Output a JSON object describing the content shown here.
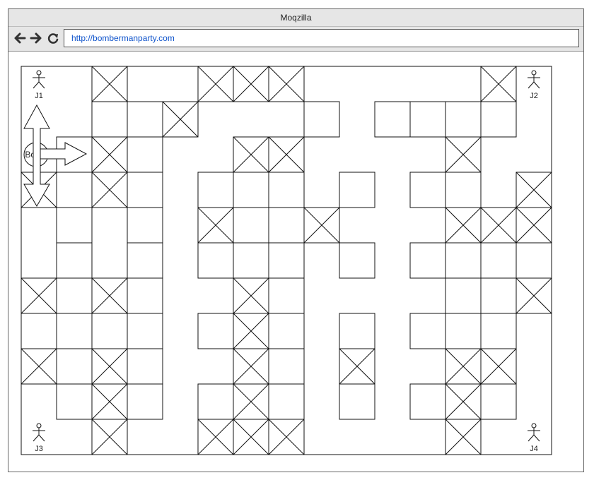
{
  "window": {
    "title": "Moqzilla"
  },
  "toolbar": {
    "back_icon": "arrow-left-icon",
    "forward_icon": "arrow-right-icon",
    "reload_icon": "reload-icon",
    "url": "http://bombermanparty.com"
  },
  "board": {
    "cols": 15,
    "rows": 11,
    "walls": [
      [
        2,
        1
      ],
      [
        3,
        1
      ],
      [
        4,
        1
      ],
      [
        8,
        1
      ],
      [
        10,
        1
      ],
      [
        11,
        1
      ],
      [
        12,
        1
      ],
      [
        13,
        1
      ],
      [
        0,
        3
      ],
      [
        1,
        3
      ],
      [
        3,
        3
      ],
      [
        5,
        3
      ],
      [
        7,
        3
      ],
      [
        9,
        3
      ],
      [
        11,
        3
      ],
      [
        12,
        3
      ],
      [
        14,
        3
      ],
      [
        1,
        5
      ],
      [
        3,
        5
      ],
      [
        5,
        5
      ],
      [
        7,
        5
      ],
      [
        9,
        5
      ],
      [
        11,
        5
      ],
      [
        13,
        5
      ],
      [
        1,
        7
      ],
      [
        3,
        7
      ],
      [
        5,
        7
      ],
      [
        7,
        7
      ],
      [
        9,
        7
      ],
      [
        11,
        7
      ],
      [
        13,
        7
      ],
      [
        1,
        9
      ],
      [
        3,
        9
      ],
      [
        5,
        9
      ],
      [
        7,
        9
      ],
      [
        9,
        9
      ],
      [
        11,
        9
      ],
      [
        13,
        9
      ],
      [
        1,
        2
      ],
      [
        2,
        2
      ],
      [
        1,
        4
      ],
      [
        1,
        6
      ],
      [
        1,
        8
      ],
      [
        3,
        2
      ],
      [
        3,
        4
      ],
      [
        3,
        6
      ],
      [
        3,
        8
      ],
      [
        6,
        2
      ],
      [
        6,
        4
      ],
      [
        6,
        6
      ],
      [
        6,
        8
      ],
      [
        7,
        2
      ],
      [
        7,
        4
      ],
      [
        7,
        6
      ],
      [
        7,
        8
      ],
      [
        12,
        2
      ],
      [
        12,
        4
      ],
      [
        12,
        6
      ],
      [
        12,
        8
      ]
    ],
    "crates": [
      [
        2,
        0
      ],
      [
        5,
        0
      ],
      [
        6,
        0
      ],
      [
        7,
        0
      ],
      [
        13,
        0
      ],
      [
        4,
        1
      ],
      [
        2,
        2
      ],
      [
        6,
        2
      ],
      [
        7,
        2
      ],
      [
        12,
        2
      ],
      [
        0,
        3
      ],
      [
        2,
        3
      ],
      [
        14,
        3
      ],
      [
        5,
        4
      ],
      [
        8,
        4
      ],
      [
        12,
        4
      ],
      [
        13,
        4
      ],
      [
        14,
        4
      ],
      [
        0,
        6
      ],
      [
        2,
        6
      ],
      [
        6,
        6
      ],
      [
        14,
        6
      ],
      [
        6,
        7
      ],
      [
        0,
        8
      ],
      [
        2,
        8
      ],
      [
        6,
        8
      ],
      [
        9,
        8
      ],
      [
        12,
        8
      ],
      [
        13,
        8
      ],
      [
        2,
        9
      ],
      [
        6,
        9
      ],
      [
        12,
        9
      ],
      [
        2,
        10
      ],
      [
        5,
        10
      ],
      [
        6,
        10
      ],
      [
        7,
        10
      ],
      [
        12,
        10
      ]
    ],
    "players": [
      {
        "label": "J1",
        "col": 0,
        "row": 0,
        "name": "player-1"
      },
      {
        "label": "J2",
        "col": 14,
        "row": 0,
        "name": "player-2"
      },
      {
        "label": "J3",
        "col": 0,
        "row": 10,
        "name": "player-3"
      },
      {
        "label": "J4",
        "col": 14,
        "row": 10,
        "name": "player-4"
      }
    ],
    "bomb": {
      "label": "Bomb",
      "col": 0,
      "row": 2
    }
  },
  "colors": {
    "line": "#111111",
    "chrome": "#e6e6e6",
    "link": "#1155cc"
  }
}
